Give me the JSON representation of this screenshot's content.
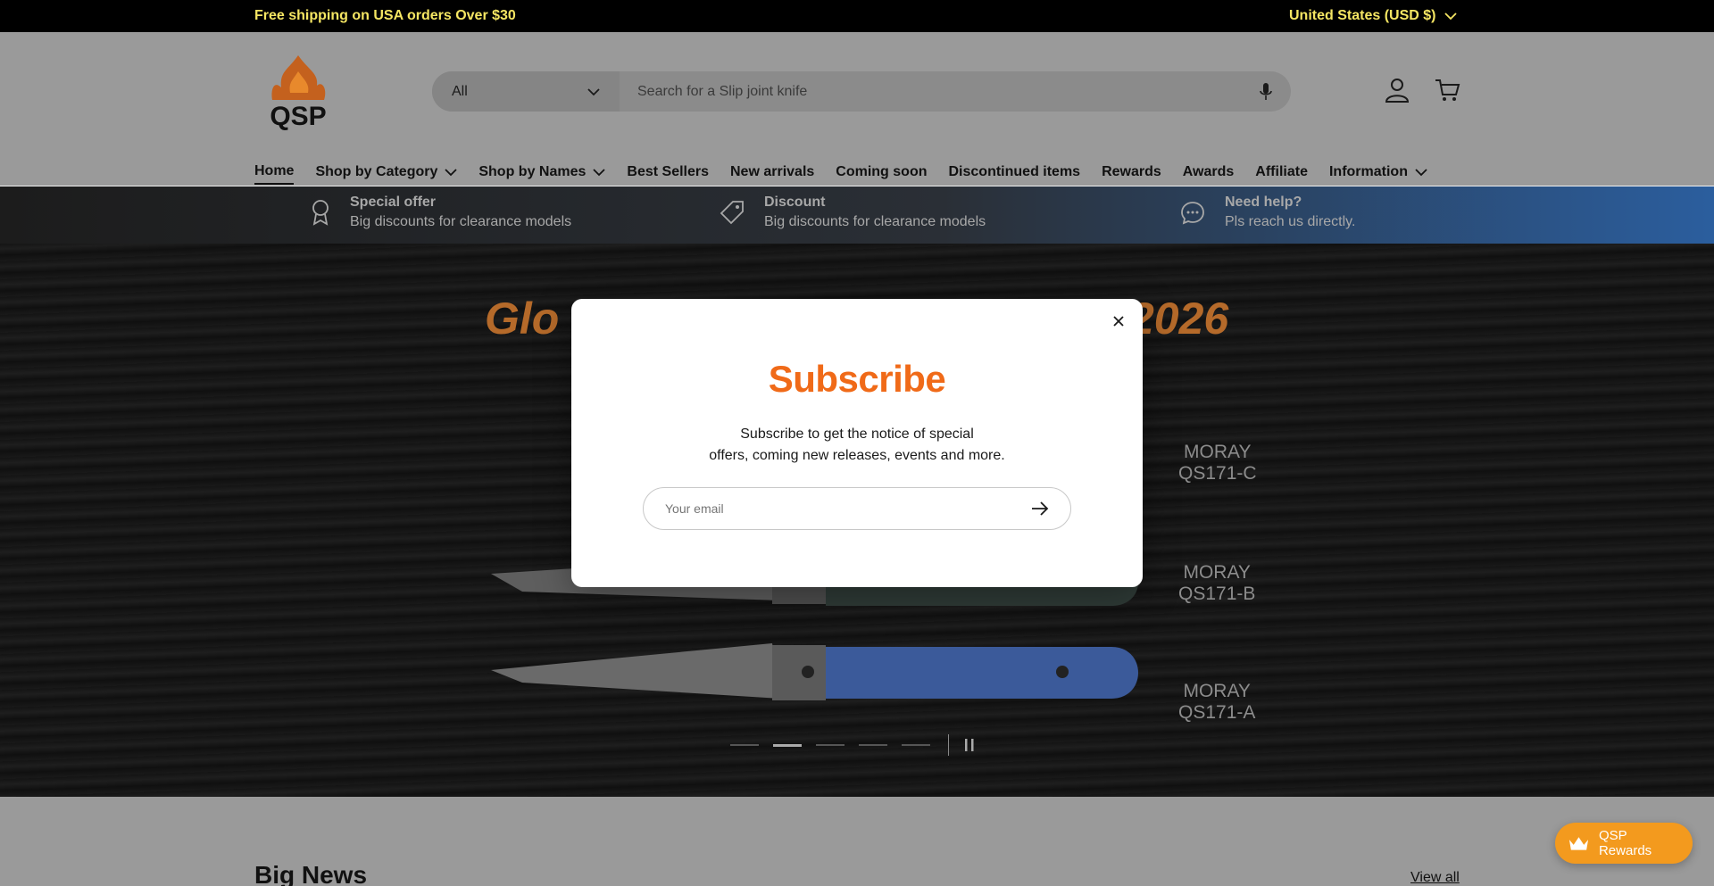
{
  "topbar": {
    "promo": "Free shipping on USA orders Over $30",
    "country": "United States (USD $)"
  },
  "header": {
    "logo_text": "QSP",
    "search": {
      "category": "All",
      "placeholder": "Search for a Slip joint knife"
    }
  },
  "nav": {
    "items": [
      {
        "label": "Home"
      },
      {
        "label": "Shop by Category"
      },
      {
        "label": "Shop by Names"
      },
      {
        "label": "Best Sellers"
      },
      {
        "label": "New arrivals"
      },
      {
        "label": "Coming soon"
      },
      {
        "label": "Discontinued items"
      },
      {
        "label": "Rewards"
      },
      {
        "label": "Awards"
      },
      {
        "label": "Affiliate"
      },
      {
        "label": "Information"
      }
    ]
  },
  "features": [
    {
      "title": "Special offer",
      "subtitle": "Big discounts for clearance models",
      "icon": "award-ribbon-icon"
    },
    {
      "title": "Discount",
      "subtitle": "Big discounts for clearance models",
      "icon": "price-tag-icon"
    },
    {
      "title": "Need help?",
      "subtitle": "Pls reach us directly.",
      "icon": "chat-bubble-icon"
    }
  ],
  "hero": {
    "title_left": "Glo",
    "title_right": "2026",
    "knives": [
      {
        "name": "MORAY",
        "model": "QS171-C"
      },
      {
        "name": "MORAY",
        "model": "QS171-B"
      },
      {
        "name": "MORAY",
        "model": "QS171-A"
      }
    ],
    "slide_count": 5,
    "active_slide": 2
  },
  "modal": {
    "title": "Subscribe",
    "body_line1": "Subscribe to get the notice of special",
    "body_line2": "offers, coming new releases, events and more.",
    "email_placeholder": "Your email"
  },
  "section": {
    "title": "Big News",
    "view_all": "View all"
  },
  "rewards": {
    "label": "QSP Rewards"
  },
  "colors": {
    "accent": "#f06a18",
    "topbar_text": "#f5e663",
    "rewards_bg": "#f39a1e"
  }
}
